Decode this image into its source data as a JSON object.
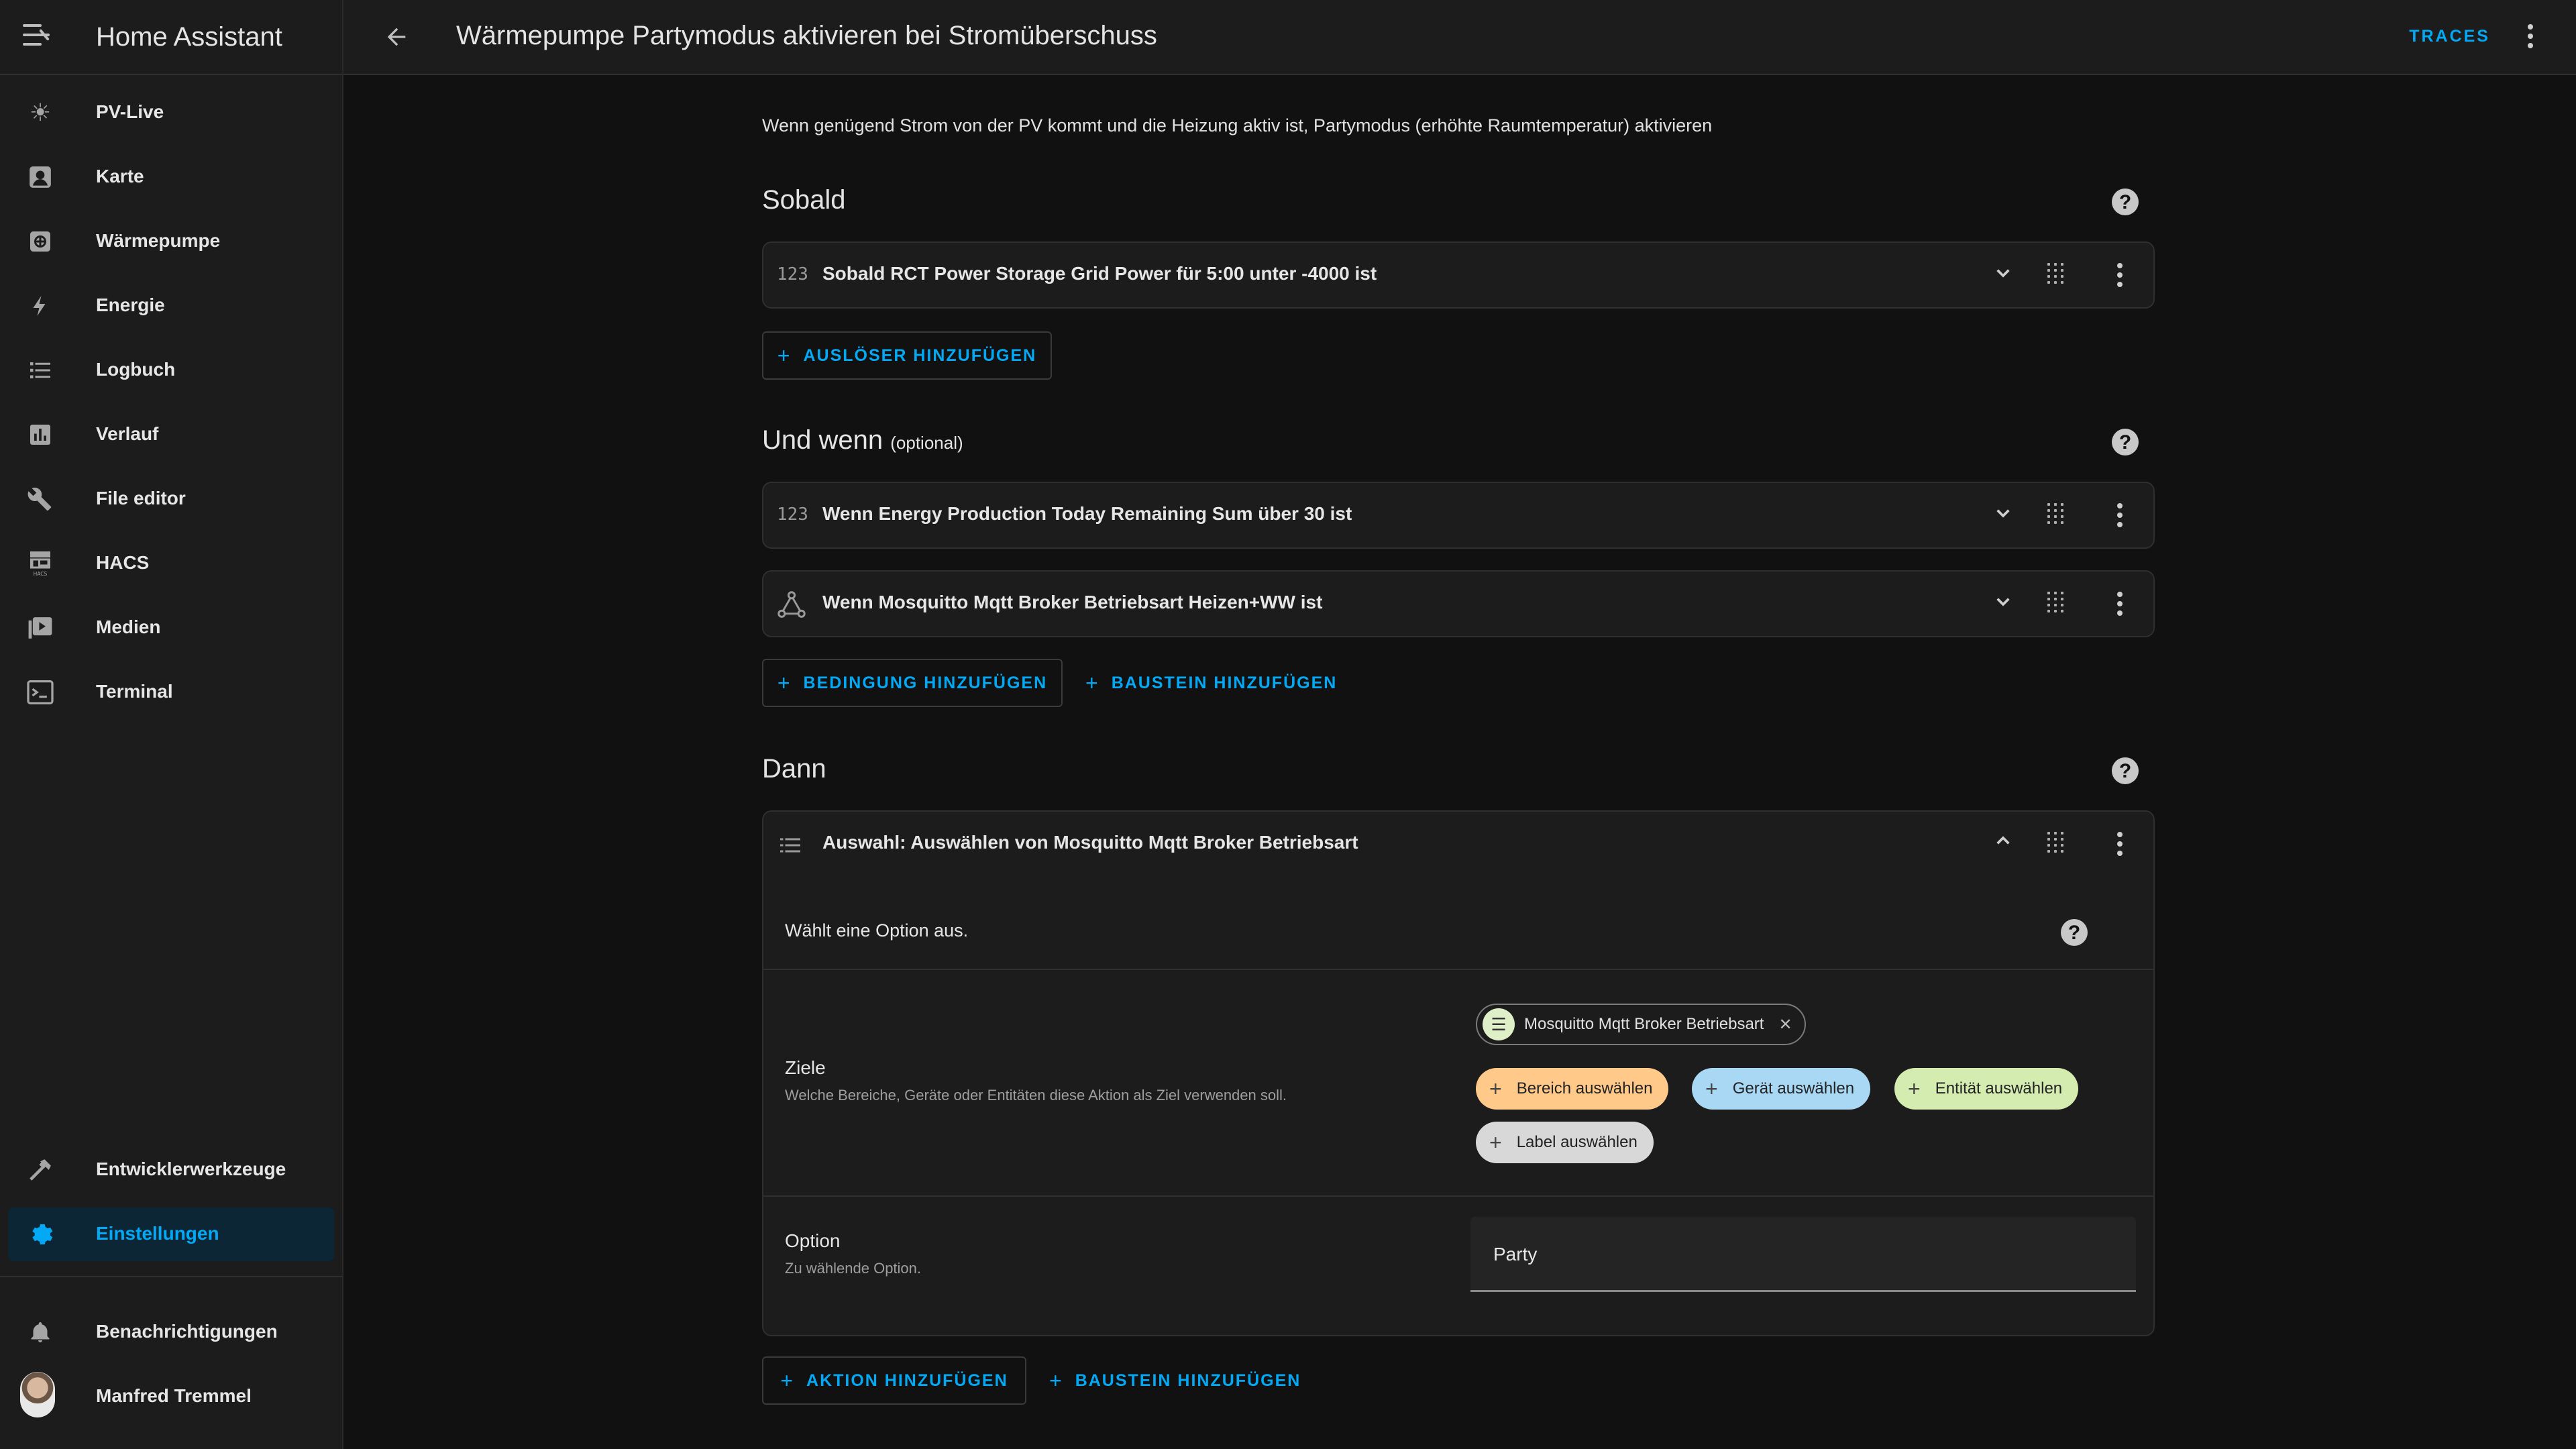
{
  "app": {
    "title": "Home Assistant"
  },
  "sidebar": {
    "items": [
      {
        "label": "PV-Live",
        "icon": "sun-icon"
      },
      {
        "label": "Karte",
        "icon": "map-marker-icon"
      },
      {
        "label": "Wärmepumpe",
        "icon": "heat-pump-icon"
      },
      {
        "label": "Energie",
        "icon": "lightning-icon"
      },
      {
        "label": "Logbuch",
        "icon": "list-icon"
      },
      {
        "label": "Verlauf",
        "icon": "chart-icon"
      },
      {
        "label": "File editor",
        "icon": "wrench-icon"
      },
      {
        "label": "HACS",
        "icon": "hacs-icon"
      },
      {
        "label": "Medien",
        "icon": "play-box-icon"
      },
      {
        "label": "Terminal",
        "icon": "console-icon"
      }
    ],
    "bottom": [
      {
        "label": "Entwicklerwerkzeuge",
        "icon": "hammer-icon"
      },
      {
        "label": "Einstellungen",
        "icon": "gear-icon",
        "active": true
      }
    ],
    "notifications": "Benachrichtigungen",
    "user": "Manfred Tremmel"
  },
  "topbar": {
    "title": "Wärmepumpe Partymodus aktivieren bei Stromüberschuss",
    "traces": "TRACES"
  },
  "description": "Wenn genügend Strom von der PV kommt und die Heizung aktiv ist, Partymodus (erhöhte Raumtemperatur) aktivieren",
  "triggers": {
    "title": "Sobald",
    "items": [
      {
        "icon": "123",
        "text": "Sobald RCT Power Storage Grid Power für 5:00 unter -4000 ist"
      }
    ],
    "add_button": "AUSLÖSER HINZUFÜGEN"
  },
  "conditions": {
    "title": "Und wenn",
    "optional": "(optional)",
    "items": [
      {
        "icon": "123",
        "text": "Wenn Energy Production Today Remaining Sum über 30 ist"
      },
      {
        "icon": "state-icon",
        "text": "Wenn Mosquitto Mqtt Broker Betriebsart Heizen+WW ist"
      }
    ],
    "add_condition": "BEDINGUNG HINZUFÜGEN",
    "add_block": "BAUSTEIN HINZUFÜGEN"
  },
  "actions": {
    "title": "Dann",
    "card": {
      "title": "Auswahl: Auswählen von Mosquitto Mqtt Broker Betriebsart",
      "description": "Wählt eine Option aus.",
      "targets": {
        "label": "Ziele",
        "hint": "Welche Bereiche, Geräte oder Entitäten diese Aktion als Ziel verwenden soll.",
        "selected": "Mosquitto Mqtt Broker Betriebsart",
        "chips": [
          {
            "label": "Bereich auswählen",
            "color": "#ffc98a"
          },
          {
            "label": "Gerät auswählen",
            "color": "#a8d8f4"
          },
          {
            "label": "Entität auswählen",
            "color": "#d4ecb0"
          },
          {
            "label": "Label auswählen",
            "color": "#d8d8d8"
          }
        ]
      },
      "option": {
        "label": "Option",
        "hint": "Zu wählende Option.",
        "value": "Party"
      }
    },
    "add_action": "AKTION HINZUFÜGEN",
    "add_block": "BAUSTEIN HINZUFÜGEN"
  },
  "colors": {
    "accent": "#03a9f4",
    "background": "#111111",
    "surface": "#1c1c1c"
  }
}
